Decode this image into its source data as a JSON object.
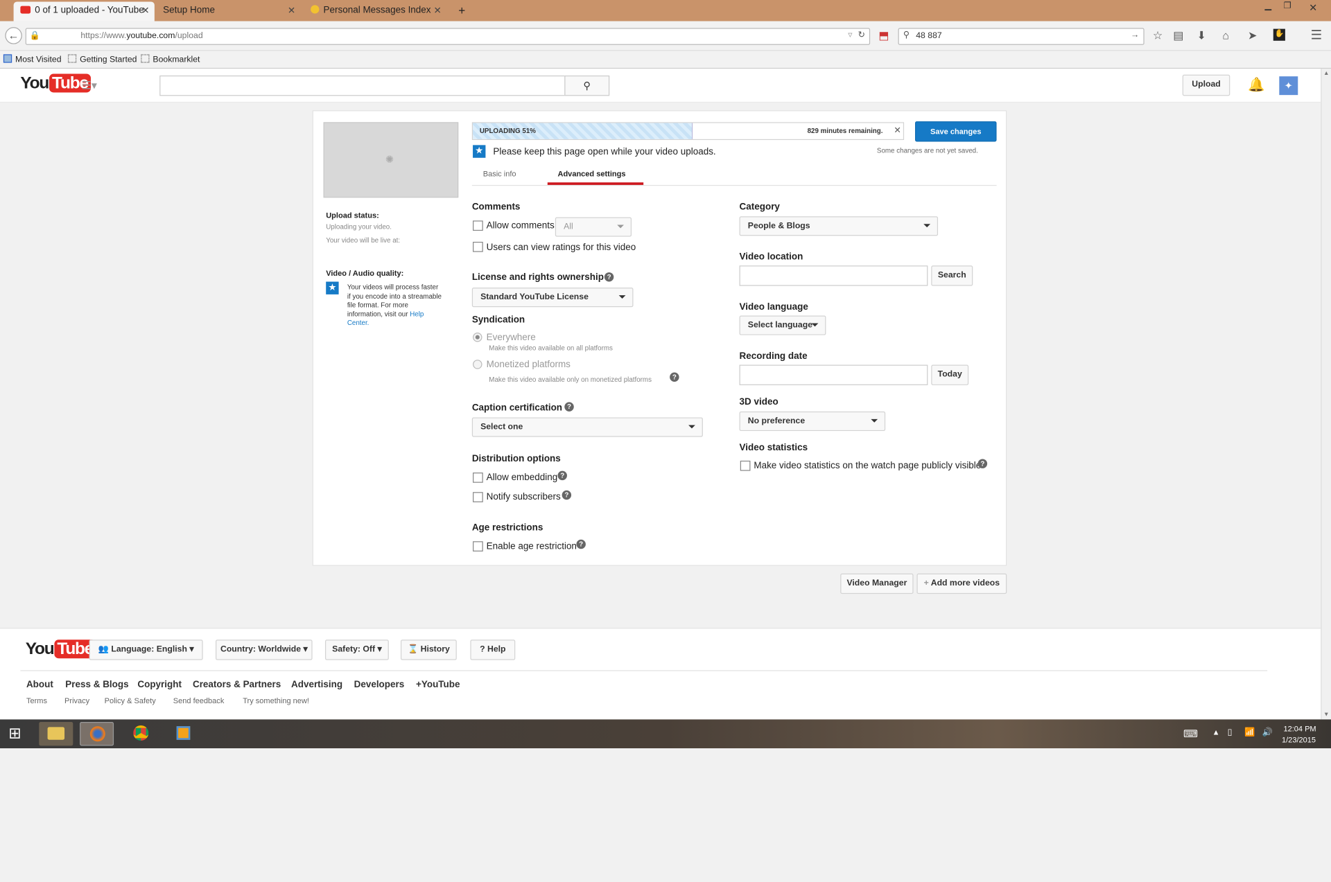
{
  "browser": {
    "tabs": [
      {
        "label": "0 of 1 uploaded - YouTube"
      },
      {
        "label": "Setup Home"
      },
      {
        "label": "Personal Messages Index"
      }
    ],
    "url_prefix": "https://www.",
    "url_domain": "youtube.com",
    "url_path": "/upload",
    "search_value": "48 887",
    "bookmarks": [
      "Most Visited",
      "Getting Started",
      "Bookmarklet"
    ]
  },
  "header": {
    "logo_you": "You",
    "logo_tube": "Tube",
    "upload_label": "Upload"
  },
  "upload": {
    "progress_label": "UPLOADING 51%",
    "progress_fraction": 0.51,
    "remaining": "829 minutes remaining.",
    "save_label": "Save changes",
    "keep_open": "Please keep this page open while your video uploads.",
    "not_saved": "Some changes are not yet saved."
  },
  "status": {
    "title": "Upload status:",
    "line1": "Uploading your video.",
    "line2": "Your video will be live at:",
    "quality_title": "Video / Audio quality:",
    "quality_text": "Your videos will process faster if you encode into a streamable file format. For more information, visit our",
    "help_link": "Help Center."
  },
  "tabs": {
    "basic": "Basic info",
    "advanced": "Advanced settings"
  },
  "left": {
    "comments_title": "Comments",
    "allow_comments": "Allow comments",
    "comments_select": "All",
    "view_ratings": "Users can view ratings for this video",
    "license_title": "License and rights ownership",
    "license_select": "Standard YouTube License",
    "syndication_title": "Syndication",
    "everywhere": "Everywhere",
    "everywhere_sub": "Make this video available on all platforms",
    "monetized": "Monetized platforms",
    "monetized_sub": "Make this video available only on monetized platforms",
    "caption_title": "Caption certification",
    "caption_select": "Select one",
    "distribution_title": "Distribution options",
    "allow_embedding": "Allow embedding",
    "notify": "Notify subscribers",
    "age_title": "Age restrictions",
    "age_restrict": "Enable age restriction"
  },
  "right": {
    "category_title": "Category",
    "category_select": "People & Blogs",
    "location_title": "Video location",
    "location_search": "Search",
    "language_title": "Video language",
    "language_select": "Select language",
    "recording_title": "Recording date",
    "today": "Today",
    "video3d_title": "3D video",
    "video3d_select": "No preference",
    "stats_title": "Video statistics",
    "stats_label": "Make video statistics on the watch page publicly visible"
  },
  "bottom": {
    "video_manager": "Video Manager",
    "add_more": "Add more videos"
  },
  "footer": {
    "language": "Language: English",
    "country": "Country: Worldwide",
    "safety": "Safety: Off",
    "history": "History",
    "help": "Help",
    "links": [
      "About",
      "Press & Blogs",
      "Copyright",
      "Creators & Partners",
      "Advertising",
      "Developers",
      "+YouTube"
    ],
    "links2": [
      "Terms",
      "Privacy",
      "Policy & Safety",
      "Send feedback",
      "Try something new!"
    ]
  },
  "taskbar": {
    "time": "12:04 PM",
    "date": "1/23/2015"
  }
}
